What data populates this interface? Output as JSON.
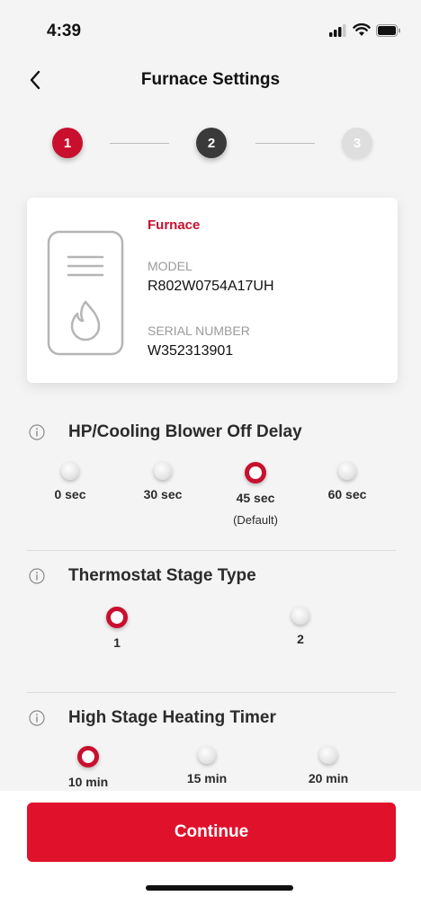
{
  "status": {
    "time": "4:39"
  },
  "nav": {
    "title": "Furnace Settings"
  },
  "stepper": {
    "steps": [
      "1",
      "2",
      "3"
    ],
    "current": 1
  },
  "device": {
    "type": "Furnace",
    "model_label": "MODEL",
    "model": "R802W0754A17UH",
    "serial_label": "SERIAL NUMBER",
    "serial": "W352313901"
  },
  "settings": [
    {
      "title": "HP/Cooling Blower Off Delay",
      "options": [
        "0 sec",
        "30 sec",
        "45 sec",
        "60 sec"
      ],
      "selected": "45 sec",
      "default_note": "(Default)"
    },
    {
      "title": "Thermostat Stage Type",
      "options": [
        "1",
        "2"
      ],
      "selected": "1"
    },
    {
      "title": "High Stage Heating Timer",
      "options": [
        "10 min",
        "15 min",
        "20 min"
      ],
      "selected": "10 min"
    }
  ],
  "actions": {
    "continue_label": "Continue"
  },
  "colors": {
    "accent": "#e0112b",
    "brand_red": "#c8102e",
    "step_dark": "#3a3a3a"
  }
}
